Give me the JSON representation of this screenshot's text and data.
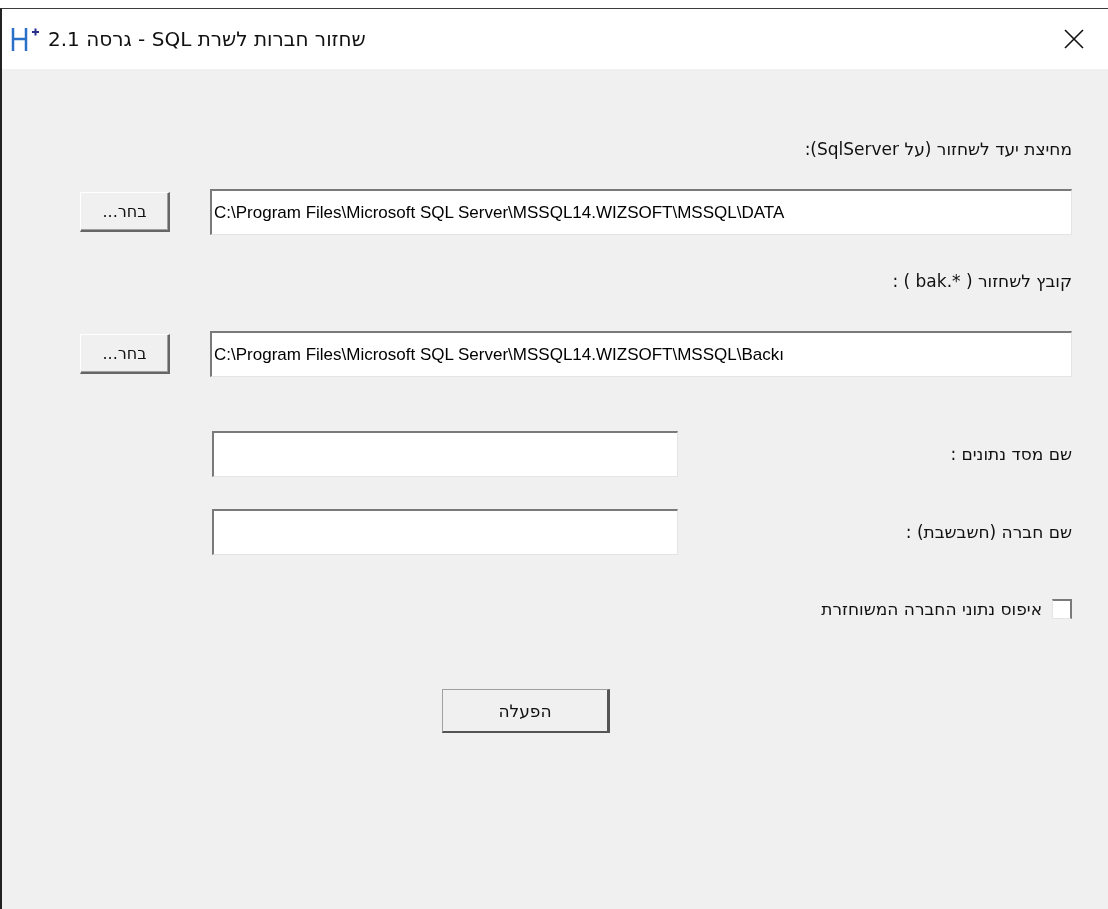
{
  "window": {
    "title": "שחזור חברות לשרת SQL - גרסה 2.1"
  },
  "target_folder": {
    "label": "מחיצת יעד לשחזור (על SqlServer):",
    "value": "C:\\Program Files\\Microsoft SQL Server\\MSSQL14.WIZSOFT\\MSSQL\\DATA",
    "button": "בחר..."
  },
  "backup_file": {
    "label": "קובץ לשחזור ( *.bak ) :",
    "value": "C:\\Program Files\\Microsoft SQL Server\\MSSQL14.WIZSOFT\\MSSQL\\Backı",
    "button": "בחר..."
  },
  "database_name": {
    "label": "שם מסד נתונים :"
  },
  "company_name": {
    "label": "שם חברה (חשבשבת) :"
  },
  "reset_option": {
    "label": "איפוס נתוני החברה המשוחזרת",
    "checked": false
  },
  "run_button": "הפעלה"
}
